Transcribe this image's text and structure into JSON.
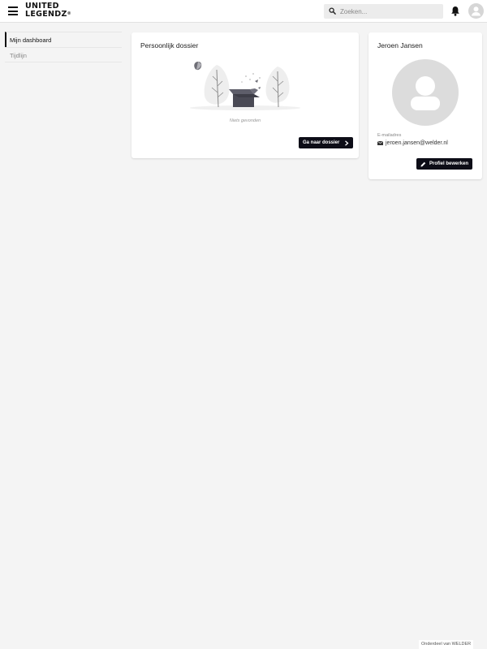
{
  "header": {
    "logo_line1": "UNITED",
    "logo_line2": "LEGENDZ",
    "logo_mark": "®",
    "search_placeholder": "Zoeken...",
    "icons": [
      "menu-icon",
      "search-icon",
      "bell-icon",
      "user-avatar-icon"
    ]
  },
  "sidebar": {
    "items": [
      {
        "label": "Mijn dashboard",
        "active": true
      },
      {
        "label": "Tijdlijn",
        "active": false
      }
    ]
  },
  "dossier": {
    "title": "Persoonlijk dossier",
    "empty_text": "Niets gevonden",
    "button_label": "Ga naar dossier"
  },
  "profile": {
    "name": "Jeroen Jansen",
    "email_label": "E-mailadres",
    "email": "jeroen.jansen@welder.nl",
    "button_label": "Profiel bewerken"
  },
  "footer": {
    "text": "Onderdeel van WELDER"
  },
  "colors": {
    "primary_button": "#0d0d17",
    "background": "#f4f4f4",
    "avatar_grey": "#dcdcdc"
  }
}
